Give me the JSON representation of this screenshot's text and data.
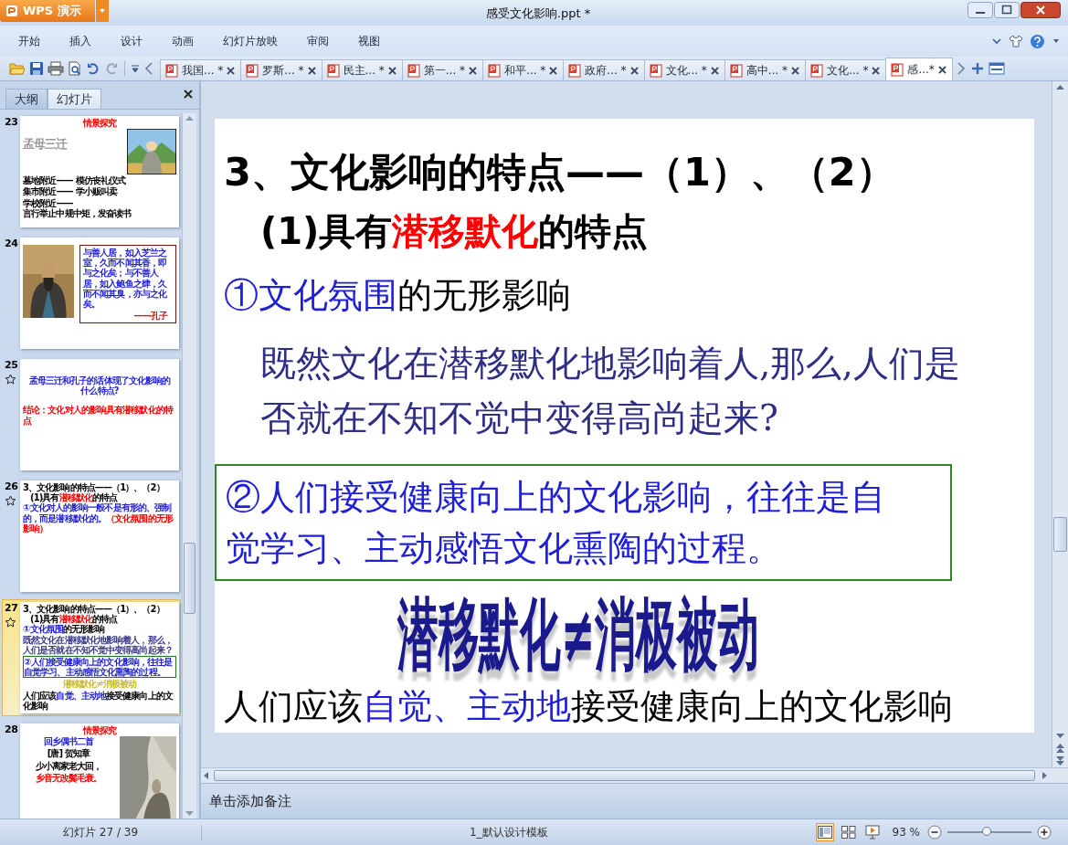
{
  "window": {
    "app_button": "WPS 演示",
    "title": "感受文化影响.ppt *"
  },
  "menu": [
    "开始",
    "插入",
    "设计",
    "动画",
    "幻灯片放映",
    "审阅",
    "视图"
  ],
  "doc_tabs": [
    {
      "label": "我国... *",
      "selected": false
    },
    {
      "label": "罗斯... *",
      "selected": false
    },
    {
      "label": "民主... *",
      "selected": false
    },
    {
      "label": "第一... *",
      "selected": false
    },
    {
      "label": "和平... *",
      "selected": false
    },
    {
      "label": "政府... *",
      "selected": false
    },
    {
      "label": "文化... *",
      "selected": false
    },
    {
      "label": "高中... *",
      "selected": false
    },
    {
      "label": "文化... *",
      "selected": false
    },
    {
      "label": "感...*",
      "selected": true
    }
  ],
  "panel": {
    "tabs": [
      {
        "label": "大纲",
        "selected": false
      },
      {
        "label": "幻灯片",
        "selected": true
      }
    ],
    "thumbnails": [
      {
        "number": "23",
        "selected": false,
        "animated": false,
        "kind": "captioned",
        "top": [
          {
            "kind": "heading",
            "segments": [
              {
                "text": "情景探究",
                "color": "#ff0000"
              }
            ]
          }
        ],
        "side": [
          {
            "kind": "faded",
            "segments": [
              {
                "text": "孟母三迁"
              }
            ]
          }
        ],
        "bottom": [
          {
            "kind": "pair",
            "segments": [
              {
                "text": "墓地附近——"
              },
              {
                "text": "模仿丧礼仪式"
              }
            ]
          },
          {
            "kind": "pair",
            "segments": [
              {
                "text": "集市附近——"
              },
              {
                "text": "学小贩叫卖"
              }
            ]
          },
          {
            "kind": "pair",
            "segments": [
              {
                "text": "学校附近——"
              },
              {
                "text": "言行举止中规中矩，发奋读书"
              }
            ]
          }
        ]
      },
      {
        "number": "24",
        "selected": false,
        "animated": false,
        "kind": "quote",
        "side": [
          {
            "kind": "quote",
            "segments": [
              {
                "text": "与善人居，如入芝兰之室，久而不闻其香，即与之化矣；与不善人居，如入鲍鱼之肆，久而不闻其臭，亦与之化矣。",
                "color": "#1f1fd6"
              }
            ]
          },
          {
            "kind": "signature",
            "segments": [
              {
                "text": "——孔子",
                "color": "#ff0000"
              }
            ]
          }
        ]
      },
      {
        "number": "25",
        "selected": false,
        "animated": true,
        "kind": "text",
        "top": [
          {
            "kind": "question",
            "segments": [
              {
                "text": "孟母三迁和孔子的话体现了文化影响的什么特点?",
                "color": "#1f1fd6"
              }
            ]
          },
          {
            "kind": "body",
            "segments": [
              {
                "text": "结论：文化对人的影响具有潜移默化的特点",
                "color": "#ff0000"
              }
            ]
          }
        ]
      },
      {
        "number": "26",
        "selected": false,
        "animated": true,
        "kind": "text",
        "top": [
          {
            "kind": "title",
            "segments": [
              {
                "text": "3、文化影响的特点——（1）、（2）"
              }
            ]
          },
          {
            "kind": "sub",
            "segments": [
              {
                "text": "(1)具有"
              },
              {
                "text": "潜移默化",
                "color": "#ff0000"
              },
              {
                "text": "的特点"
              }
            ]
          },
          {
            "kind": "body",
            "segments": [
              {
                "text": "①文化对人的影响一般不是有形的、强制的，而是潜移默化的。",
                "color": "#1f1fd6"
              },
              {
                "text": "（文化氛围的无形影响）",
                "color": "#ff0000"
              }
            ]
          }
        ]
      },
      {
        "number": "27",
        "selected": true,
        "animated": true,
        "kind": "text",
        "top": [
          {
            "kind": "title",
            "segments": [
              {
                "text": "3、文化影响的特点——（1）、（2）"
              }
            ]
          },
          {
            "kind": "sub",
            "segments": [
              {
                "text": "(1)具有"
              },
              {
                "text": "潜移默化",
                "color": "#ff0000"
              },
              {
                "text": "的特点"
              }
            ]
          },
          {
            "kind": "body",
            "segments": [
              {
                "text": "①文化氛围",
                "color": "#1f1fd6"
              },
              {
                "text": "的无形影响"
              }
            ]
          },
          {
            "kind": "para",
            "segments": [
              {
                "text": "既然文化在潜移默化地影响着人，那么，人们是否就在不知不觉中变得高尚起来？"
              }
            ]
          },
          {
            "kind": "boxed",
            "segments": [
              {
                "text": "②人们接受健康向上的文化影响，往往是自觉学习、主动感悟文化熏陶的过程。",
                "color": "#1f1fd6"
              }
            ]
          },
          {
            "kind": "wordart",
            "segments": [
              {
                "text": "潜移默化≠消极被动"
              }
            ]
          },
          {
            "kind": "body",
            "segments": [
              {
                "text": "人们应该"
              },
              {
                "text": "自觉、主动地",
                "color": "#1f1fd6"
              },
              {
                "text": "接受健康向上的文化影响"
              }
            ]
          }
        ]
      },
      {
        "number": "28",
        "selected": false,
        "animated": false,
        "kind": "captioned",
        "top": [
          {
            "kind": "heading",
            "segments": [
              {
                "text": "情景探究",
                "color": "#ff0000"
              }
            ]
          }
        ],
        "side": [
          {
            "kind": "poem",
            "segments": [
              {
                "text": "回乡偶书二首",
                "color": "#1f1fd6"
              }
            ]
          },
          {
            "kind": "poem",
            "segments": [
              {
                "text": "[唐] 贺知章"
              }
            ]
          },
          {
            "kind": "poem",
            "segments": [
              {
                "text": "少小离家老大回，"
              }
            ]
          },
          {
            "kind": "poem",
            "segments": [
              {
                "text": "乡音无改鬓毛衰。",
                "color": "#ff0000"
              }
            ]
          }
        ]
      }
    ]
  },
  "slide": {
    "title": "3、文化影响的特点——（1）、（2）",
    "subtitle": [
      {
        "text": "(1)"
      },
      {
        "text": "具有"
      },
      {
        "text": "潜移默化",
        "color": "#ff0000"
      },
      {
        "text": "的特点"
      }
    ],
    "point": [
      {
        "text": "①文化氛围",
        "color": "#1f1fd6"
      },
      {
        "text": "的无形影响"
      }
    ],
    "question": "既然文化在潜移默化地影响着人,那么,人们是否就在不知不觉中变得高尚起来?",
    "boxed": "②人们接受健康向上的文化影响，往往是自觉学习、主动感悟文化熏陶的过程。",
    "wordart": "潜移默化≠消极被动",
    "conclusion": [
      {
        "text": "人们应该"
      },
      {
        "text": "自觉、主动地",
        "color": "#1f1fd6"
      },
      {
        "text": "接受健康向上的文化影响"
      }
    ]
  },
  "notes": {
    "hint": "单击添加备注"
  },
  "status_bar": {
    "slide_counter": "幻灯片 27 / 39",
    "template": "1_默认设计模板",
    "views": [
      {
        "kind": "normal",
        "selected": true
      },
      {
        "kind": "sorter",
        "selected": false
      },
      {
        "kind": "show",
        "selected": false
      }
    ],
    "zoom_text": "93 %",
    "zoom": {
      "level": 0.47
    }
  }
}
